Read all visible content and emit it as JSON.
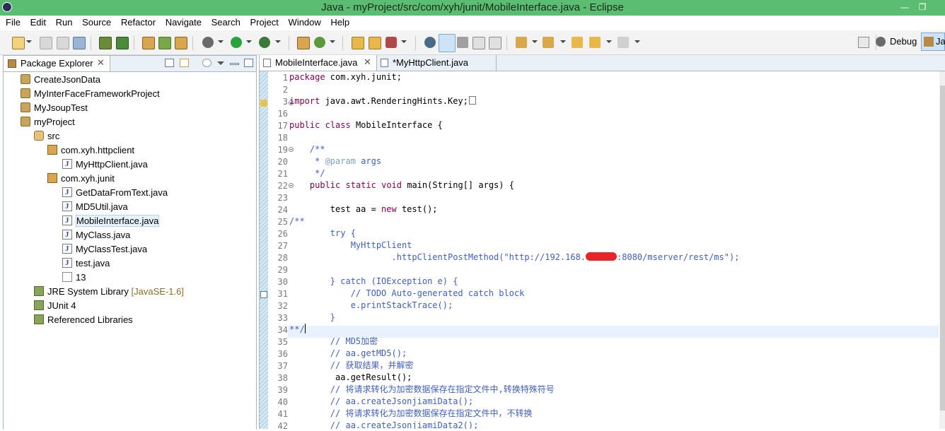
{
  "window": {
    "title": "Java - myProject/src/com/xyh/junit/MobileInterface.java - Eclipse"
  },
  "menu": [
    "File",
    "Edit",
    "Run",
    "Source",
    "Refactor",
    "Navigate",
    "Search",
    "Project",
    "Window",
    "Help"
  ],
  "perspectives": {
    "debug": "Debug",
    "java": "Ja"
  },
  "package_explorer": {
    "title": "Package Explorer",
    "items": [
      {
        "label": "CreateJsonData",
        "icon": "project-icon"
      },
      {
        "label": "MyInterFaceFrameworkProject",
        "icon": "project-icon"
      },
      {
        "label": "MyJsoupTest",
        "icon": "project-icon"
      },
      {
        "label": "myProject",
        "icon": "project-icon"
      },
      {
        "label": "src",
        "icon": "source-folder-icon"
      },
      {
        "label": "com.xyh.httpclient",
        "icon": "package-icon"
      },
      {
        "label": "MyHttpClient.java",
        "icon": "java-file-icon"
      },
      {
        "label": "com.xyh.junit",
        "icon": "package-icon"
      },
      {
        "label": "GetDataFromText.java",
        "icon": "java-file-icon"
      },
      {
        "label": "MD5Util.java",
        "icon": "java-file-icon"
      },
      {
        "label": "MobileInterface.java",
        "icon": "java-file-icon",
        "selected": true
      },
      {
        "label": "MyClass.java",
        "icon": "java-file-icon"
      },
      {
        "label": "MyClassTest.java",
        "icon": "java-file-icon"
      },
      {
        "label": "test.java",
        "icon": "java-file-icon"
      },
      {
        "label": "13",
        "icon": "file-icon"
      },
      {
        "label": "JRE System Library",
        "suffix": "[JavaSE-1.6]",
        "icon": "library-icon"
      },
      {
        "label": "JUnit 4",
        "icon": "library-icon"
      },
      {
        "label": "Referenced Libraries",
        "icon": "library-icon"
      }
    ]
  },
  "editor": {
    "tabs": [
      {
        "label": "MobileInterface.java",
        "active": true
      },
      {
        "label": "*MyHttpClient.java",
        "active": false
      }
    ],
    "line_numbers": [
      "1",
      "2",
      "3",
      "16",
      "17",
      "18",
      "19",
      "20",
      "21",
      "22",
      "23",
      "24",
      "25",
      "26",
      "27",
      "28",
      "29",
      "30",
      "31",
      "32",
      "33",
      "34",
      "35",
      "36",
      "37",
      "38",
      "39",
      "40",
      "41",
      "42"
    ],
    "code": {
      "l1": "package com.xyh.junit;",
      "l3": "import java.awt.RenderingHints.Key;",
      "l17": "public class MobileInterface {",
      "l19": "    /**",
      "l20a": "     * ",
      "l20b": "@param",
      "l20c": " args",
      "l21": "     */",
      "l22": "    public static void main(String[] args) {",
      "l24": "        test aa = new test();",
      "l25": "/**",
      "l26": "        try {",
      "l27": "            MyHttpClient",
      "l28a": "                    .httpClientPostMethod(\"http://192.168.",
      "l28b": ":8080/mserver/rest/ms\");",
      "l30": "        } catch (IOException e) {",
      "l31a": "            // ",
      "l31b": "TODO",
      "l31c": " Auto-generated catch block",
      "l32": "            e.printStackTrace();",
      "l33": "        }",
      "l34": "**/",
      "l35": "        // MD5加密",
      "l36": "        // aa.getMD5();",
      "l37": "        // 获取结果，并解密",
      "l38": "         aa.getResult();",
      "l39": "        // 将请求转化为加密数据保存在指定文件中,转换特殊符号",
      "l40": "        // aa.createJsonjiamiData();",
      "l41": "        // 将请求转化为加密数据保存在指定文件中，不转换",
      "l42": "        // aa.createJsonjiamiData2();"
    }
  }
}
